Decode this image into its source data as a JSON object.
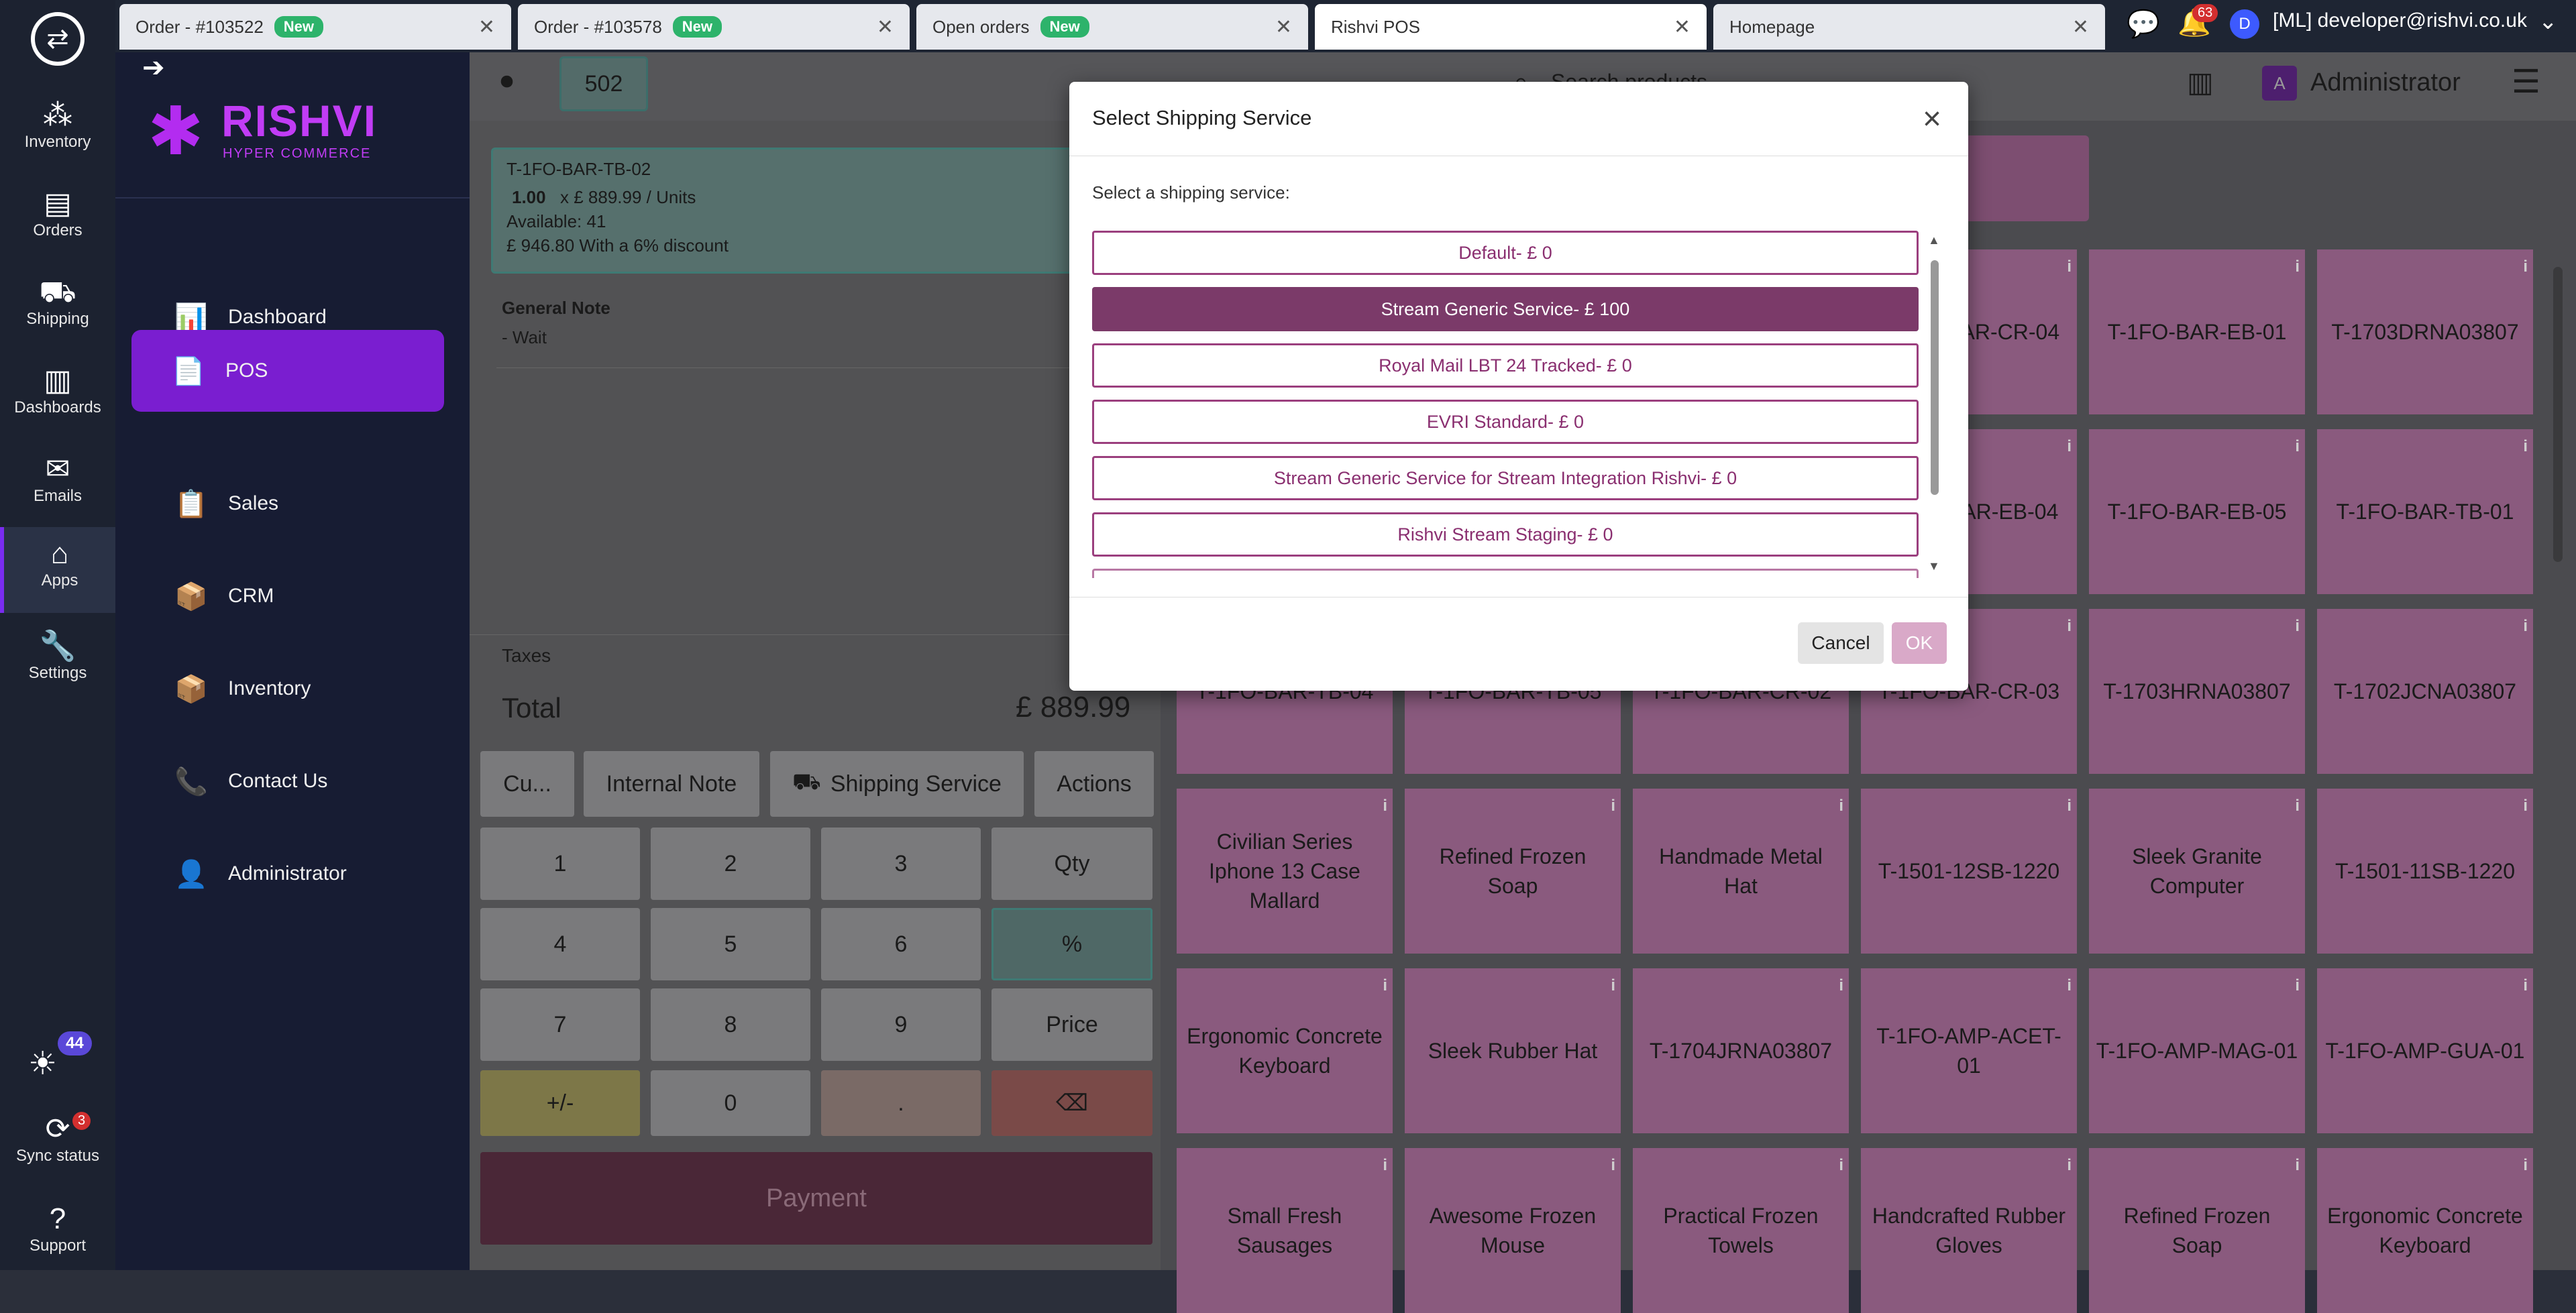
{
  "browser": {
    "tabs": [
      {
        "label": "Order - #103522",
        "badge": "New"
      },
      {
        "label": "Order - #103578",
        "badge": "New"
      },
      {
        "label": "Open orders",
        "badge": "New"
      },
      {
        "label": "Rishvi POS",
        "badge": ""
      },
      {
        "label": "Homepage",
        "badge": ""
      }
    ],
    "notification_count": "63",
    "user_initial": "D",
    "user_email": "[ML] developer@rishvi.co.uk"
  },
  "rail": {
    "items": [
      {
        "label": "Inventory",
        "icon": "bubbles-icon"
      },
      {
        "label": "Orders",
        "icon": "orders-icon"
      },
      {
        "label": "Shipping",
        "icon": "truck-icon"
      },
      {
        "label": "Dashboards",
        "icon": "chart-icon"
      },
      {
        "label": "Emails",
        "icon": "mail-icon"
      },
      {
        "label": "Apps",
        "icon": "apps-icon"
      },
      {
        "label": "Settings",
        "icon": "wrench-icon"
      }
    ],
    "theme_count": "44",
    "sync_label": "Sync status",
    "sync_count": "3",
    "support_label": "Support"
  },
  "sidebar": {
    "logo_title": "RISHVI",
    "logo_subtitle": "HYPER COMMERCE",
    "items": [
      {
        "label": "Dashboard"
      },
      {
        "label": "POS"
      },
      {
        "label": "Sales"
      },
      {
        "label": "CRM"
      },
      {
        "label": "Inventory"
      },
      {
        "label": "Contact Us"
      },
      {
        "label": "Administrator"
      }
    ]
  },
  "pos": {
    "order_number": "502",
    "search_placeholder": "Search products...",
    "admin_initial": "A",
    "admin_label": "Administrator",
    "line": {
      "sku": "T-1FO-BAR-TB-02",
      "qty": "1.00",
      "price": "x £ 889.99 / Units",
      "available": "Available: 41",
      "discount": "£ 946.80 With a 6% discount"
    },
    "note_title": "General Note",
    "note_text": "- Wait",
    "taxes_label": "Taxes",
    "total_label": "Total",
    "total_value": "£ 889.99",
    "actions": {
      "customer": "Cu...",
      "internal_note": "Internal Note",
      "shipping": "Shipping Service",
      "actions": "Actions"
    },
    "keypad": [
      "1",
      "2",
      "3",
      "Qty",
      "4",
      "5",
      "6",
      "%",
      "7",
      "8",
      "9",
      "Price",
      "+/-",
      "0",
      ".",
      ""
    ],
    "payment": "Payment"
  },
  "products": [
    "",
    "",
    "",
    "T-1FO-BAR-CR-04",
    "T-1FO-BAR-EB-01",
    "T-1703DRNA03807",
    "",
    "",
    "",
    "T-1FO-BAR-EB-04",
    "T-1FO-BAR-EB-05",
    "T-1FO-BAR-TB-01",
    "T-1FO-BAR-TB-04",
    "T-1FO-BAR-TB-05",
    "T-1FO-BAR-CR-02",
    "T-1FO-BAR-CR-03",
    "T-1703HRNA03807",
    "T-1702JCNA03807",
    "Civilian Series Iphone 13 Case Mallard",
    "Refined Frozen Soap",
    "Handmade Metal Hat",
    "T-1501-12SB-1220",
    "Sleek Granite Computer",
    "T-1501-11SB-1220",
    "Ergonomic Concrete Keyboard",
    "Sleek Rubber Hat",
    "T-1704JRNA03807",
    "T-1FO-AMP-ACET-01",
    "T-1FO-AMP-MAG-01",
    "T-1FO-AMP-GUA-01",
    "Small Fresh Sausages",
    "Awesome Frozen Mouse",
    "Practical Frozen Towels",
    "Handcrafted Rubber Gloves",
    "Refined Frozen Soap",
    "Ergonomic Concrete Keyboard"
  ],
  "modal": {
    "title": "Select Shipping Service",
    "prompt": "Select a shipping service:",
    "options": [
      {
        "label": "Default- £ 0"
      },
      {
        "label": "Stream Generic Service- £ 100"
      },
      {
        "label": "Royal Mail LBT 24 Tracked- £ 0"
      },
      {
        "label": "EVRI Standard- £ 0"
      },
      {
        "label": "Stream Generic Service for Stream Integration Rishvi- £ 0"
      },
      {
        "label": "Rishvi Stream Staging- £ 0"
      }
    ],
    "selected_index": 1,
    "cancel": "Cancel",
    "ok": "OK"
  },
  "colors": {
    "accent": "#7a1ed0",
    "selected_option": "#7b3a69",
    "product_tile": "#e3a3d2"
  }
}
